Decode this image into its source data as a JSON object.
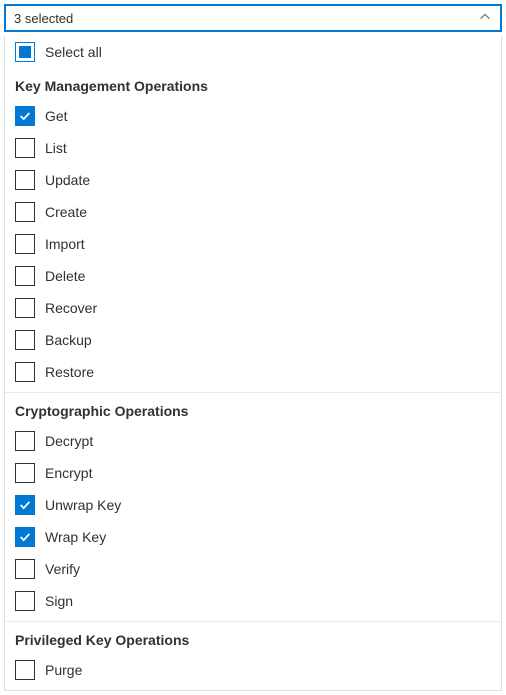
{
  "header": {
    "summary": "3 selected"
  },
  "select_all_label": "Select all",
  "select_all_state": "indeterminate",
  "groups": [
    {
      "title": "Key Management Operations",
      "items": [
        {
          "label": "Get",
          "checked": true
        },
        {
          "label": "List",
          "checked": false
        },
        {
          "label": "Update",
          "checked": false
        },
        {
          "label": "Create",
          "checked": false
        },
        {
          "label": "Import",
          "checked": false
        },
        {
          "label": "Delete",
          "checked": false
        },
        {
          "label": "Recover",
          "checked": false
        },
        {
          "label": "Backup",
          "checked": false
        },
        {
          "label": "Restore",
          "checked": false
        }
      ]
    },
    {
      "title": "Cryptographic Operations",
      "items": [
        {
          "label": "Decrypt",
          "checked": false
        },
        {
          "label": "Encrypt",
          "checked": false
        },
        {
          "label": "Unwrap Key",
          "checked": true
        },
        {
          "label": "Wrap Key",
          "checked": true
        },
        {
          "label": "Verify",
          "checked": false
        },
        {
          "label": "Sign",
          "checked": false
        }
      ]
    },
    {
      "title": "Privileged Key Operations",
      "items": [
        {
          "label": "Purge",
          "checked": false
        }
      ]
    }
  ]
}
